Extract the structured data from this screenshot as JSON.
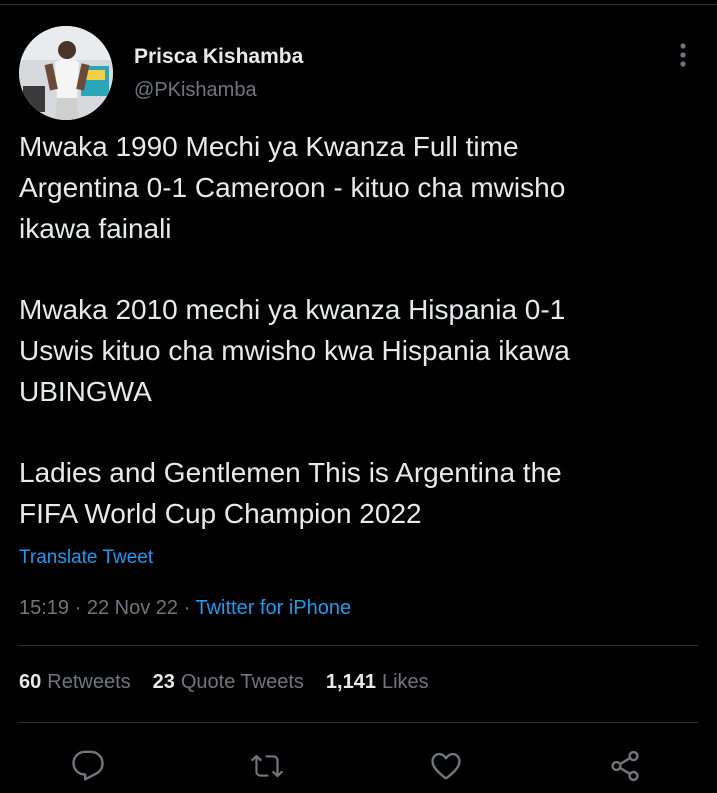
{
  "colors": {
    "background": "#000000",
    "text": "#e7e9ea",
    "muted": "#71767b",
    "link": "#1d9bf0",
    "divider": "#2f3336"
  },
  "author": {
    "name": "Prisca Kishamba",
    "handle": "@PKishamba",
    "avatar_icon": "profile-photo"
  },
  "tweet": {
    "paragraphs": [
      "Mwaka 1990 Mechi ya Kwanza Full time\nArgentina 0-1 Cameroon - kituo cha mwisho\nikawa fainali",
      "Mwaka 2010 mechi ya kwanza Hispania 0-1\nUswis kituo cha mwisho kwa Hispania ikawa\nUBINGWA",
      "Ladies and Gentlemen This is Argentina the\nFIFA World Cup Champion 2022"
    ],
    "translate_label": "Translate Tweet",
    "time": "15:19",
    "date": "22 Nov 22",
    "separator": "·",
    "source": "Twitter for iPhone"
  },
  "stats": {
    "retweets": {
      "count": "60",
      "label": "Retweets"
    },
    "quotes": {
      "count": "23",
      "label": "Quote Tweets"
    },
    "likes": {
      "count": "1,141",
      "label": "Likes"
    }
  },
  "actions": {
    "reply_icon": "reply-icon",
    "retweet_icon": "retweet-icon",
    "like_icon": "heart-icon",
    "share_icon": "share-icon",
    "more_icon": "more-vertical-icon"
  }
}
